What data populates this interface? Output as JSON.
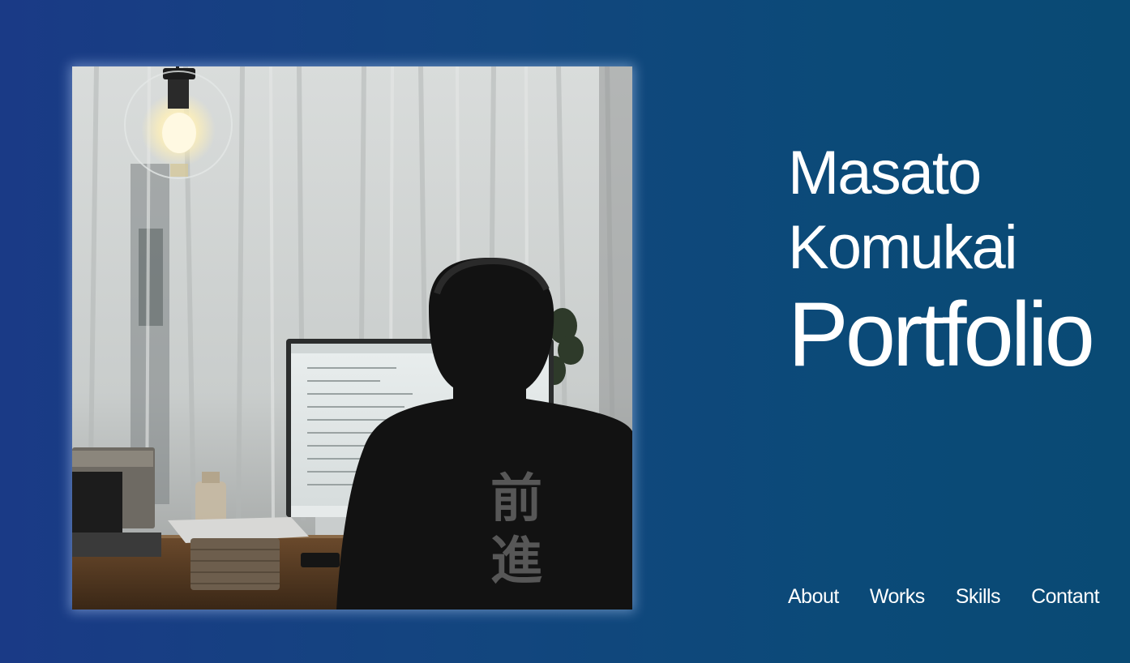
{
  "header": {
    "name_first": "Masato",
    "name_last": "Komukai",
    "subtitle": "Portfolio"
  },
  "hero_image": {
    "shirt_text_line1": "前",
    "shirt_text_line2": "進"
  },
  "nav": {
    "items": [
      "About",
      "Works",
      "Skills",
      "Contant"
    ]
  },
  "colors": {
    "background_left": "#1a3a86",
    "background_right": "#094a74",
    "text": "#ffffff"
  }
}
